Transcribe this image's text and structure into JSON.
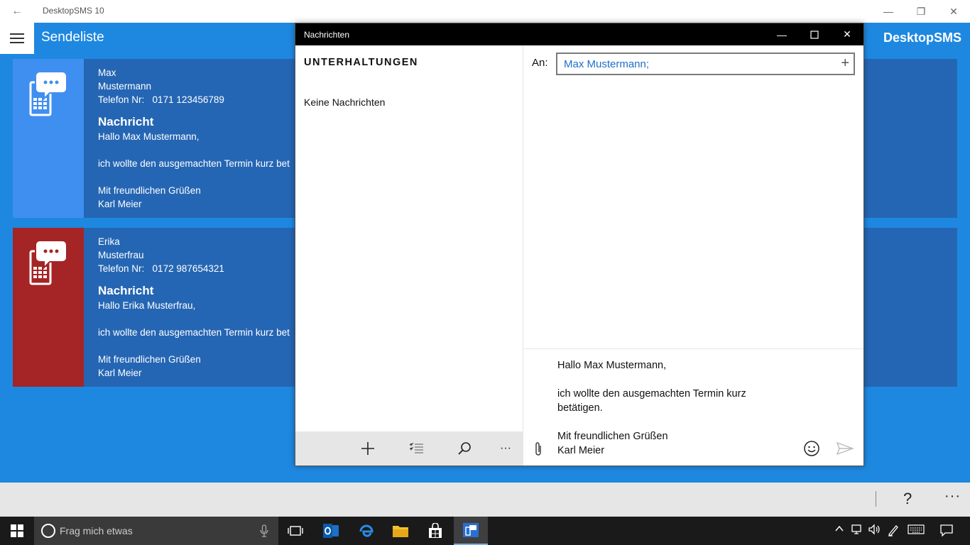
{
  "titlebar": {
    "app_title": "DesktopSMS 10",
    "back_icon": "←",
    "minimize_icon": "—",
    "restore_icon": "❐",
    "close_icon": "✕"
  },
  "header": {
    "page_title": "Sendeliste",
    "brand": "DesktopSMS"
  },
  "cards": [
    {
      "first_name": "Max",
      "last_name": "Mustermann",
      "phone_label": "Telefon Nr:",
      "phone": "0171 123456789",
      "heading": "Nachricht",
      "greeting": "Hallo Max Mustermann,",
      "body": "ich wollte den ausgemachten Termin kurz bet",
      "closing": "Mit freundlichen Grüßen",
      "signature": "Karl Meier",
      "accent_color": "#3f8ff0"
    },
    {
      "first_name": "Erika",
      "last_name": "Musterfrau",
      "phone_label": "Telefon Nr:",
      "phone": "0172 987654321",
      "heading": "Nachricht",
      "greeting": "Hallo Erika Musterfrau,",
      "body": "ich wollte den ausgemachten Termin kurz bet",
      "closing": "Mit freundlichen Grüßen",
      "signature": "Karl Meier",
      "accent_color": "#a52426"
    }
  ],
  "messages_window": {
    "title": "Nachrichten",
    "conversations_header": "UNTERHALTUNGEN",
    "empty_text": "Keine Nachrichten",
    "to_label": "An:",
    "to_value": "Max Mustermann;",
    "compose": {
      "line1": "Hallo Max Mustermann,",
      "line2": "ich wollte den ausgemachten Termin kurz",
      "line3": "betätigen.",
      "line4": "Mit freundlichen Grüßen",
      "line5": "Karl Meier"
    },
    "toolbar_icons": [
      "add-icon",
      "select-list-icon",
      "search-icon",
      "more-icon"
    ]
  },
  "appbar": {
    "help": "?",
    "more": "···"
  },
  "taskbar": {
    "search_placeholder": "Frag mich etwas"
  }
}
